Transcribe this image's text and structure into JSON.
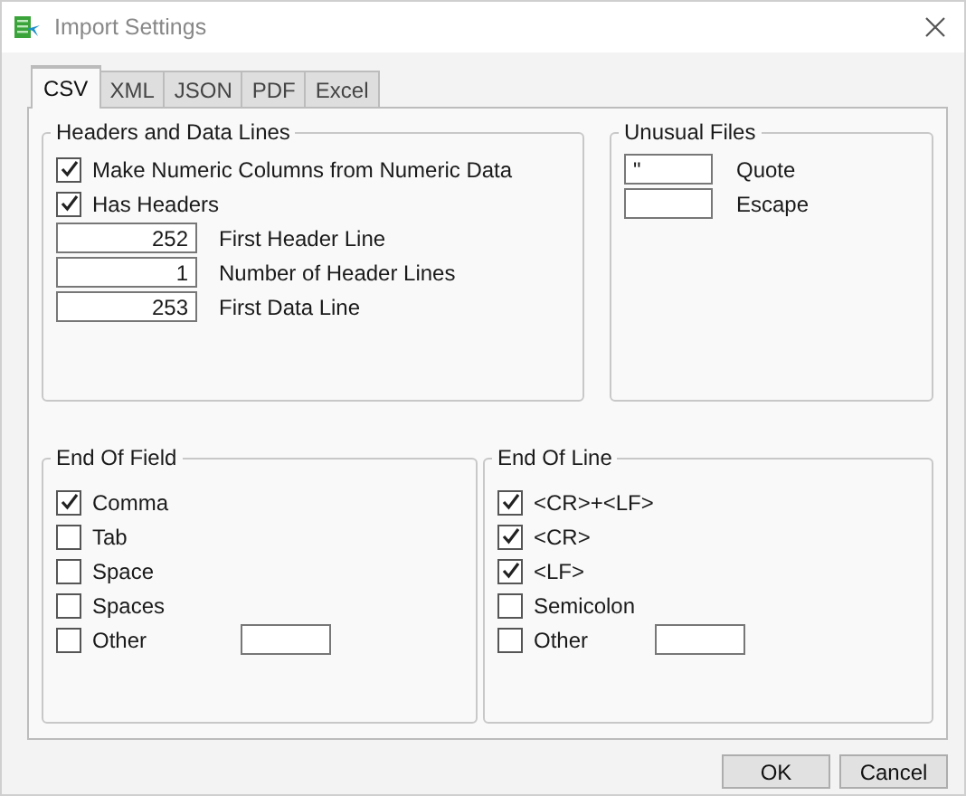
{
  "window": {
    "title": "Import Settings"
  },
  "tabs": [
    {
      "label": "CSV",
      "selected": true
    },
    {
      "label": "XML",
      "selected": false
    },
    {
      "label": "JSON",
      "selected": false
    },
    {
      "label": "PDF",
      "selected": false
    },
    {
      "label": "Excel",
      "selected": false
    }
  ],
  "groups": [
    {
      "title": "Headers and Data Lines",
      "items": [
        {
          "kind": "checkbox",
          "label": "Make Numeric Columns from Numeric Data",
          "checked": true
        },
        {
          "kind": "checkbox",
          "label": "Has Headers",
          "checked": true
        }
      ],
      "fields": [
        {
          "kind": "number",
          "label": "First Header Line",
          "value": "252"
        },
        {
          "kind": "number",
          "label": "Number of Header Lines",
          "value": "1"
        },
        {
          "kind": "number",
          "label": "First Data Line",
          "value": "253"
        }
      ]
    },
    {
      "title": "Unusual Files",
      "fields": [
        {
          "kind": "text",
          "label": "Quote",
          "value": "\""
        },
        {
          "kind": "text",
          "label": "Escape"
        }
      ]
    },
    {
      "title": "End Of Field",
      "items": [
        {
          "kind": "checkbox",
          "label": "Comma",
          "checked": true
        },
        {
          "kind": "checkbox",
          "label": "Tab",
          "checked": false
        },
        {
          "kind": "checkbox",
          "label": "Space",
          "checked": false
        },
        {
          "kind": "checkbox",
          "label": "Spaces",
          "checked": false
        },
        {
          "kind": "checkfield",
          "label": "Other",
          "checked": false
        }
      ]
    },
    {
      "title": "End Of Line",
      "items": [
        {
          "kind": "checkbox",
          "label": "<CR>+<LF>",
          "checked": true
        },
        {
          "kind": "checkbox",
          "label": "<CR>",
          "checked": true
        },
        {
          "kind": "checkbox",
          "label": "<LF>",
          "checked": true
        },
        {
          "kind": "checkbox",
          "label": "Semicolon",
          "checked": false
        },
        {
          "kind": "checkfield",
          "label": "Other",
          "checked": false
        }
      ]
    }
  ],
  "buttons": [
    "OK",
    "Cancel"
  ]
}
